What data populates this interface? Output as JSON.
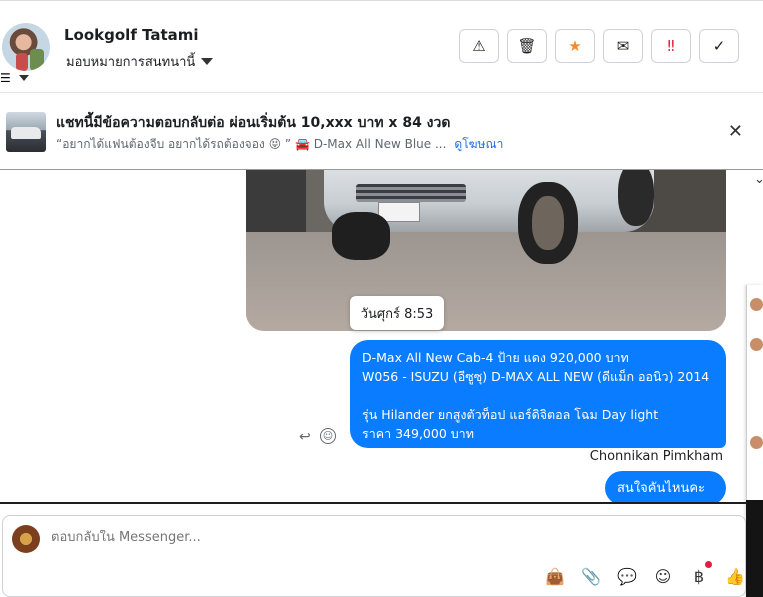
{
  "header": {
    "contact_name": "Lookgolf Tatami",
    "assign_label": "มอบหมายการสนทนานี้",
    "filter_icon": "☰",
    "actions": [
      {
        "name": "report-spam-button",
        "glyph": "⚠",
        "color": "#1c1e21"
      },
      {
        "name": "delete-button",
        "glyph": "🗑",
        "color": "#1c1e21"
      },
      {
        "name": "star-button",
        "glyph": "★",
        "color": "#f28c28"
      },
      {
        "name": "mark-unread-button",
        "glyph": "✉",
        "color": "#1c1e21"
      },
      {
        "name": "follow-up-button",
        "glyph": "‼",
        "color": "#e41e3f"
      },
      {
        "name": "mark-done-button",
        "glyph": "✓",
        "color": "#1c1e21"
      }
    ]
  },
  "ad": {
    "title": "แชทนี้มีข้อความตอบกลับต่อ ผ่อนเริ่มต้น 10,xxx บาท x 84 งวด",
    "subtitle": "“อยากได้แฟนต้องจีบ อยากได้รถต้องจอง 😝 ” 🚘 D-Max All New Blue ...",
    "link": "ดูโฆษณา",
    "close": "✕"
  },
  "messages": {
    "timestamp": "วันศุกร์ 8:53",
    "main_lines": [
      "D-Max All New Cab-4 ป้าย แดง 920,000 บาท",
      "W056 - ISUZU (อีซูซุ) D-MAX ALL NEW (ดีแม็ก ออนิว) 2014",
      "",
      " รุ่น Hilander ยกสูงตัวท็อป แอร์ดิจิตอล โฉม Day light",
      "ราคา 349,000 บาท"
    ],
    "sender": "Chonnikan Pimkham",
    "short_reply": "สนใจคันไหนคะ",
    "reply_glyph": "↩",
    "react_glyph": "☺"
  },
  "composer": {
    "placeholder": "ตอบกลับใน Messenger...",
    "tools": [
      {
        "name": "shopping-bag-icon",
        "glyph": "👜"
      },
      {
        "name": "attachment-icon",
        "glyph": "📎"
      },
      {
        "name": "saved-reply-icon",
        "glyph": "💬"
      },
      {
        "name": "emoji-icon",
        "glyph": "☺"
      },
      {
        "name": "baht-payment-icon",
        "glyph": "฿"
      },
      {
        "name": "thumbs-up-icon",
        "glyph": "👍"
      }
    ]
  },
  "colors": {
    "accent": "#0a7cff",
    "link": "#216fdb"
  }
}
